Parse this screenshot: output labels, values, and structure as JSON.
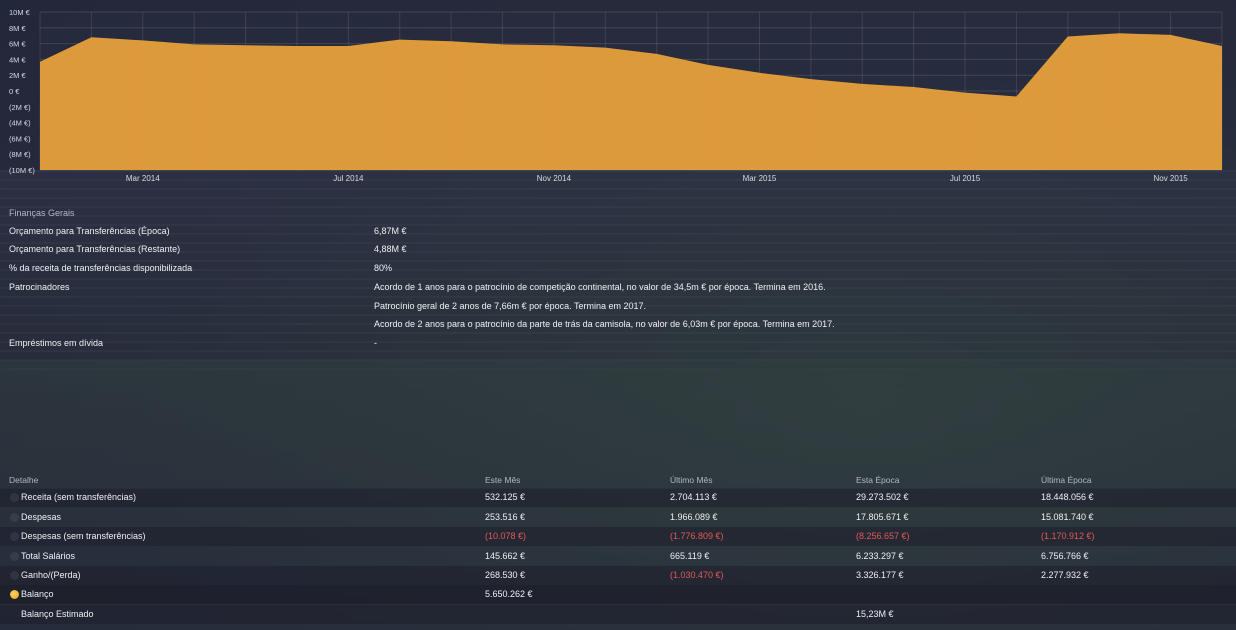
{
  "colors": {
    "area_fill": "#eba33a",
    "negative": "#e45757"
  },
  "chart_data": {
    "type": "area",
    "y_tick_labels": [
      "10M €",
      "8M €",
      "6M €",
      "4M €",
      "2M €",
      "0 €",
      "(2M €)",
      "(4M €)",
      "(6M €)",
      "(8M €)",
      "(10M €)"
    ],
    "ylim": [
      -10000000,
      10000000
    ],
    "x_tick_labels": [
      "Mar 2014",
      "Jul 2014",
      "Nov 2014",
      "Mar 2015",
      "Jul 2015",
      "Nov 2015"
    ],
    "x": [
      "Jan 2014",
      "Feb 2014",
      "Mar 2014",
      "Apr 2014",
      "May 2014",
      "Jun 2014",
      "Jul 2014",
      "Aug 2014",
      "Sep 2014",
      "Oct 2014",
      "Nov 2014",
      "Dec 2014",
      "Jan 2015",
      "Feb 2015",
      "Mar 2015",
      "Apr 2015",
      "May 2015",
      "Jun 2015",
      "Jul 2015",
      "Aug 2015",
      "Sep 2015",
      "Oct 2015",
      "Nov 2015",
      "Dec 2015"
    ],
    "values": [
      3700000,
      6800000,
      6400000,
      5900000,
      5800000,
      5700000,
      5700000,
      6500000,
      6300000,
      5900000,
      5800000,
      5500000,
      4700000,
      3300000,
      2300000,
      1500000,
      900000,
      500000,
      -200000,
      -700000,
      6900000,
      7300000,
      7100000,
      5700000
    ],
    "grid": true
  },
  "general": {
    "title": "Finanças Gerais",
    "rows": [
      {
        "label": "Orçamento para Transferências (Época)",
        "value": "6,87M €"
      },
      {
        "label": "Orçamento para Transferências (Restante)",
        "value": "4,88M €"
      },
      {
        "label": "% da receita de transferências disponibilizada",
        "value": "80%"
      },
      {
        "label": "Patrocinadores",
        "value": "Acordo de 1 anos para o patrocínio de competição continental, no valor de 34,5m € por época. Termina em 2016."
      },
      {
        "label": "",
        "value": "Patrocínio geral de 2 anos de 7,66m € por época. Termina em 2017."
      },
      {
        "label": "",
        "value": "Acordo de 2 anos para o patrocínio da parte de trás da camisola, no valor de 6,03m € por época. Termina em 2017."
      },
      {
        "label": "Empréstimos em dívida",
        "value": "-"
      }
    ]
  },
  "detail": {
    "headers": [
      "Detalhe",
      "Este Mês",
      "Último Mês",
      "Esta Época",
      "Última Época"
    ],
    "rows": [
      {
        "label": "Receita (sem transferências)",
        "cells": [
          "532.125 €",
          "2.704.113 €",
          "29.273.502 €",
          "18.448.056 €"
        ],
        "neg": [
          false,
          false,
          false,
          false
        ]
      },
      {
        "label": "Despesas",
        "cells": [
          "253.516 €",
          "1.966.089 €",
          "17.805.671 €",
          "15.081.740 €"
        ],
        "neg": [
          false,
          false,
          false,
          false
        ]
      },
      {
        "label": "Despesas (sem transferências)",
        "cells": [
          "(10.078 €)",
          "(1.776.809 €)",
          "(8.256.657 €)",
          "(1.170.912 €)"
        ],
        "neg": [
          true,
          true,
          true,
          true
        ]
      },
      {
        "label": "Total Salários",
        "cells": [
          "145.662 €",
          "665.119 €",
          "6.233.297 €",
          "6.756.766 €"
        ],
        "neg": [
          false,
          false,
          false,
          false
        ]
      },
      {
        "label": "Ganho/(Perda)",
        "cells": [
          "268.530 €",
          "(1.030.470 €)",
          "3.326.177 €",
          "2.277.932 €"
        ],
        "neg": [
          false,
          true,
          false,
          false
        ]
      }
    ],
    "balance": {
      "label": "Balanço",
      "value": "5.650.262 €"
    },
    "estimated": {
      "label": "Balanço Estimado",
      "value": "15,23M €"
    }
  }
}
